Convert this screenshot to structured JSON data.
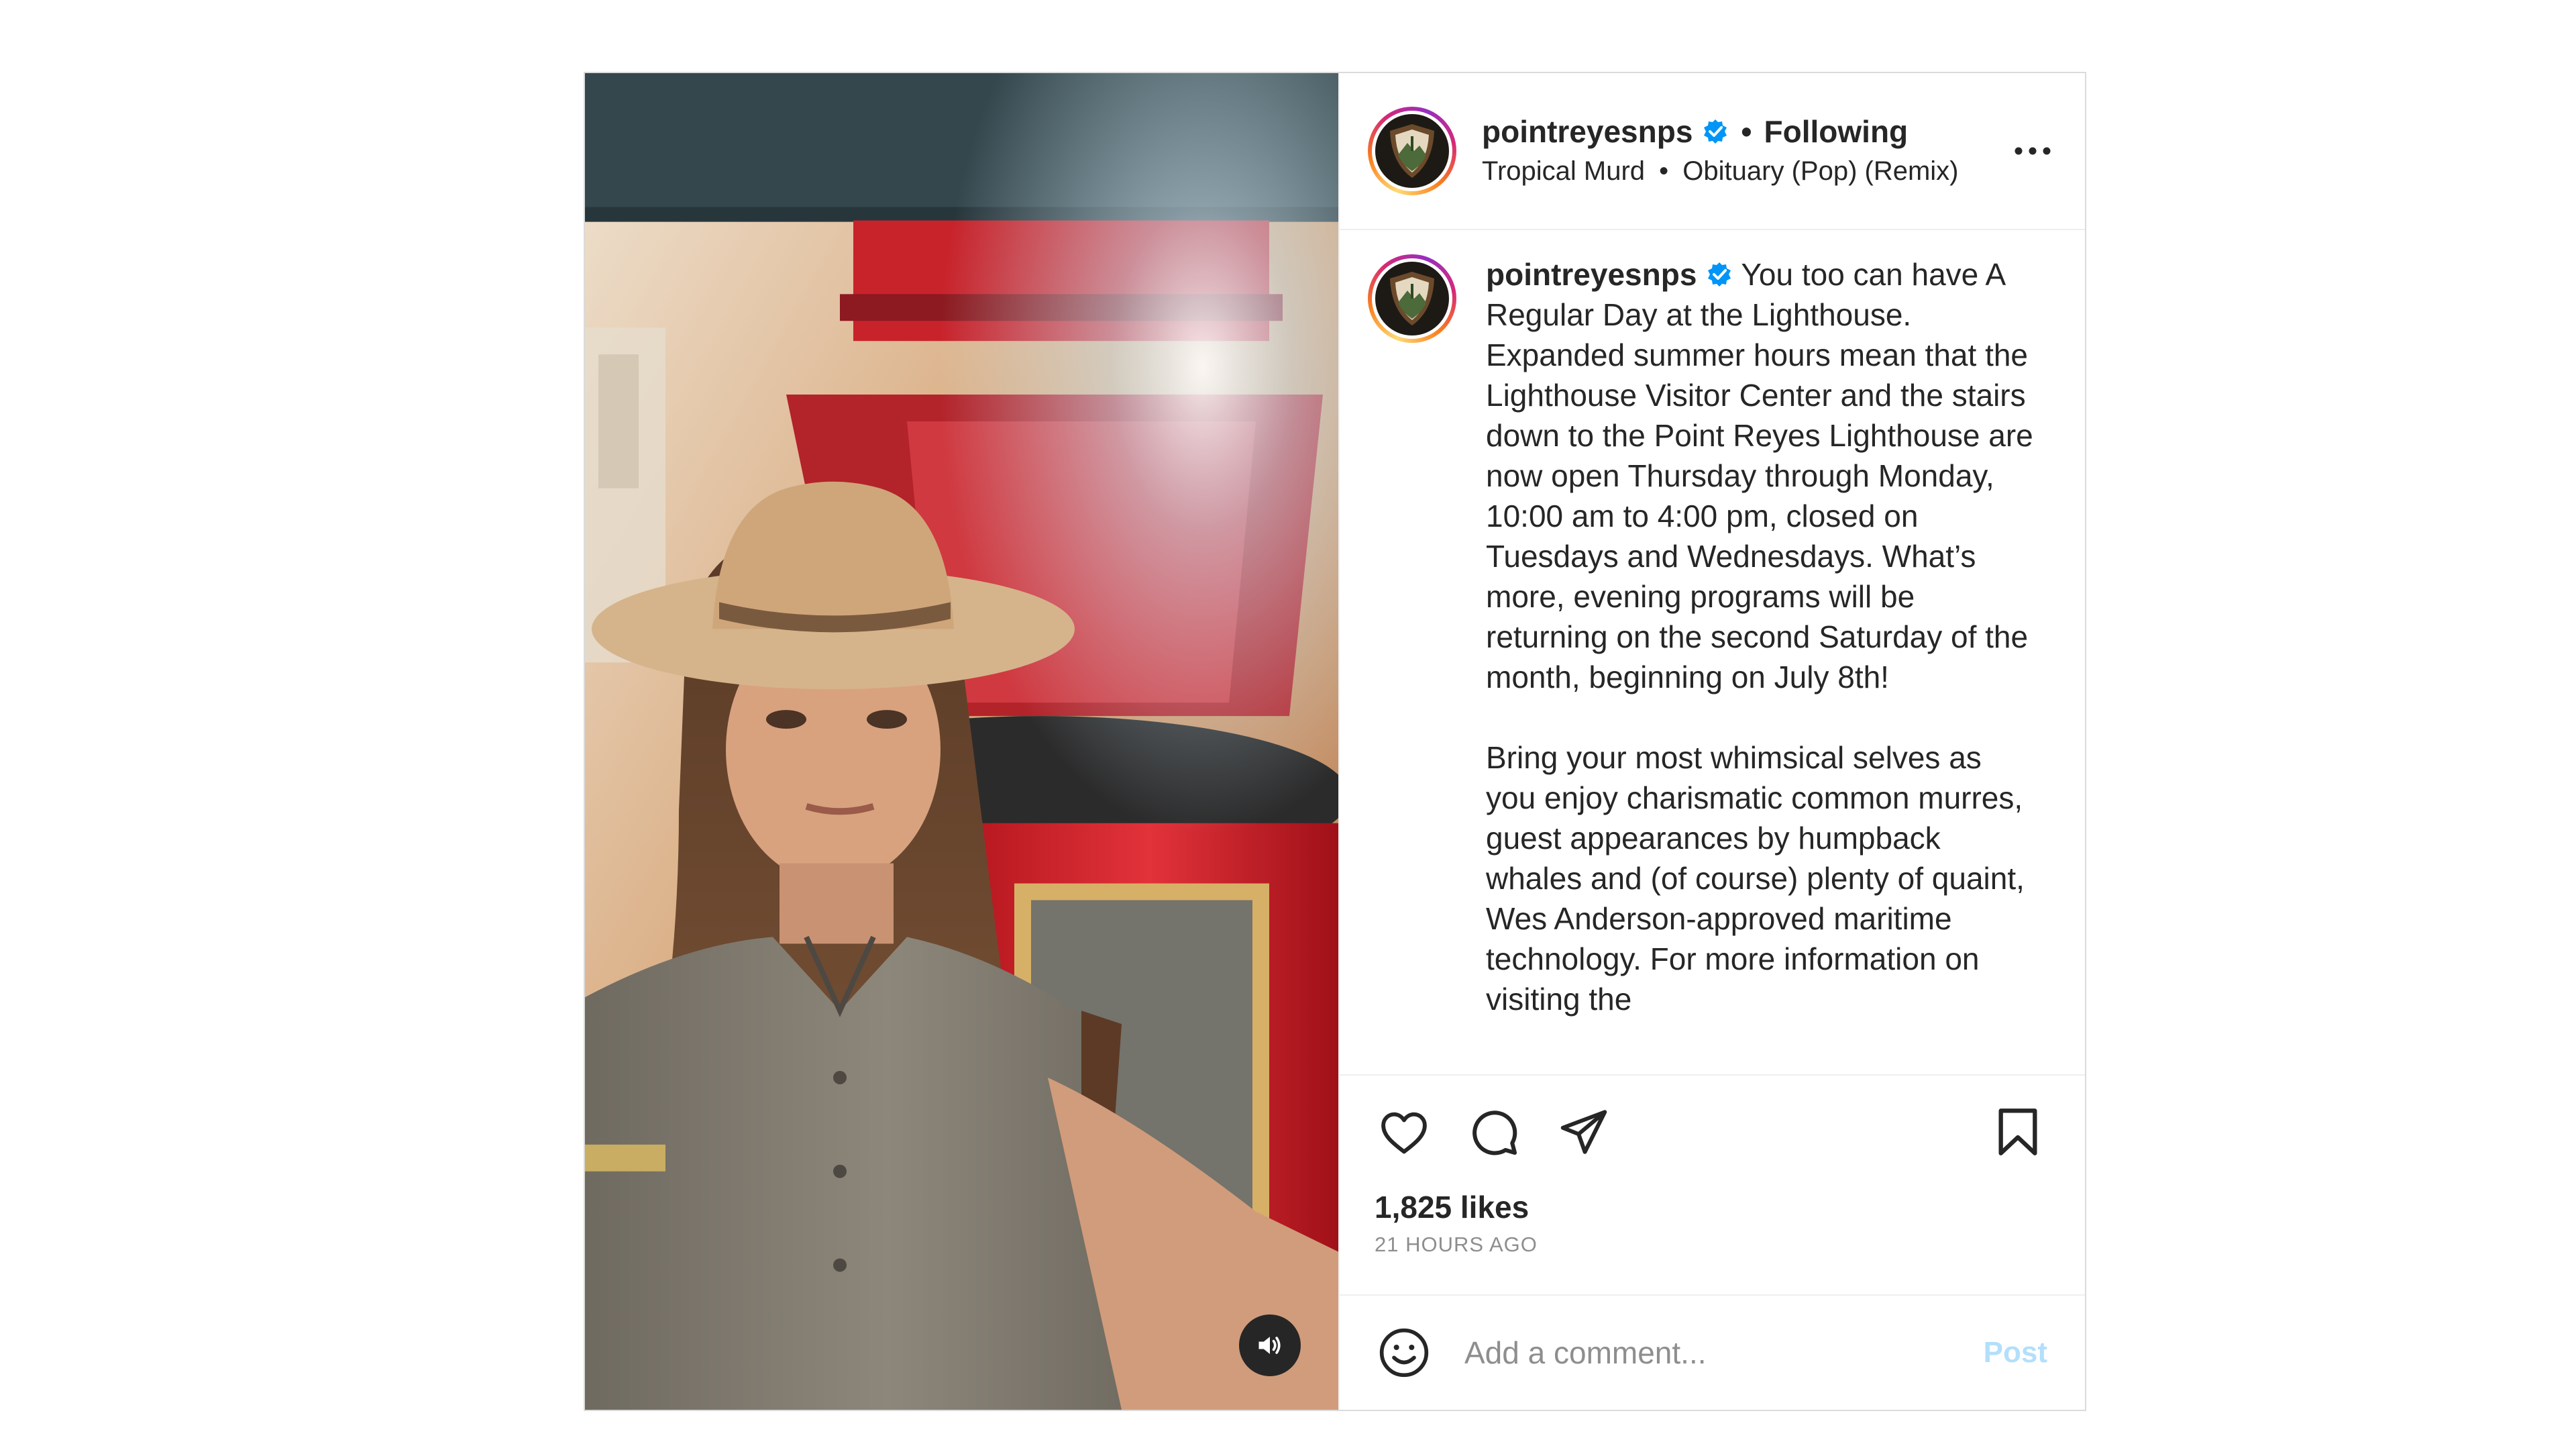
{
  "post": {
    "username": "pointreyesnps",
    "follow_status": "Following",
    "separator": "•",
    "audio": {
      "artist": "Tropical Murd",
      "separator": "•",
      "track": "Obituary (Pop) (Remix)"
    },
    "caption": {
      "username": "pointreyesnps",
      "text": "You too can have A Regular Day at the Lighthouse. Expanded summer hours mean that the Lighthouse Visitor Center and the stairs down to the Point Reyes Lighthouse are now open Thursday through Monday, 10:00 am to 4:00 pm, closed on Tuesdays and Wednesdays. What’s more, evening programs will be returning on the second Saturday of the month, beginning on July 8th!\n\nBring your most whimsical selves as you enjoy charismatic common murres, guest appearances by humpback whales and (of course) plenty of quaint, Wes Anderson-approved maritime technology. For more information on visiting the"
    },
    "likes": "1,825 likes",
    "time_ago": "21 HOURS AGO",
    "comment": {
      "placeholder": "Add a comment...",
      "post_label": "Post"
    }
  },
  "icons": {
    "verified": "verified-badge-icon",
    "more": "more-options-icon",
    "like": "heart-icon",
    "comment": "comment-icon",
    "share": "share-icon",
    "save": "bookmark-icon",
    "emoji": "emoji-icon",
    "audio": "speaker-icon"
  },
  "colors": {
    "verified_blue": "#0095f6",
    "post_button_disabled": "#b2dffc",
    "border": "#dbdbdb",
    "muted_text": "#8e8e8e"
  }
}
